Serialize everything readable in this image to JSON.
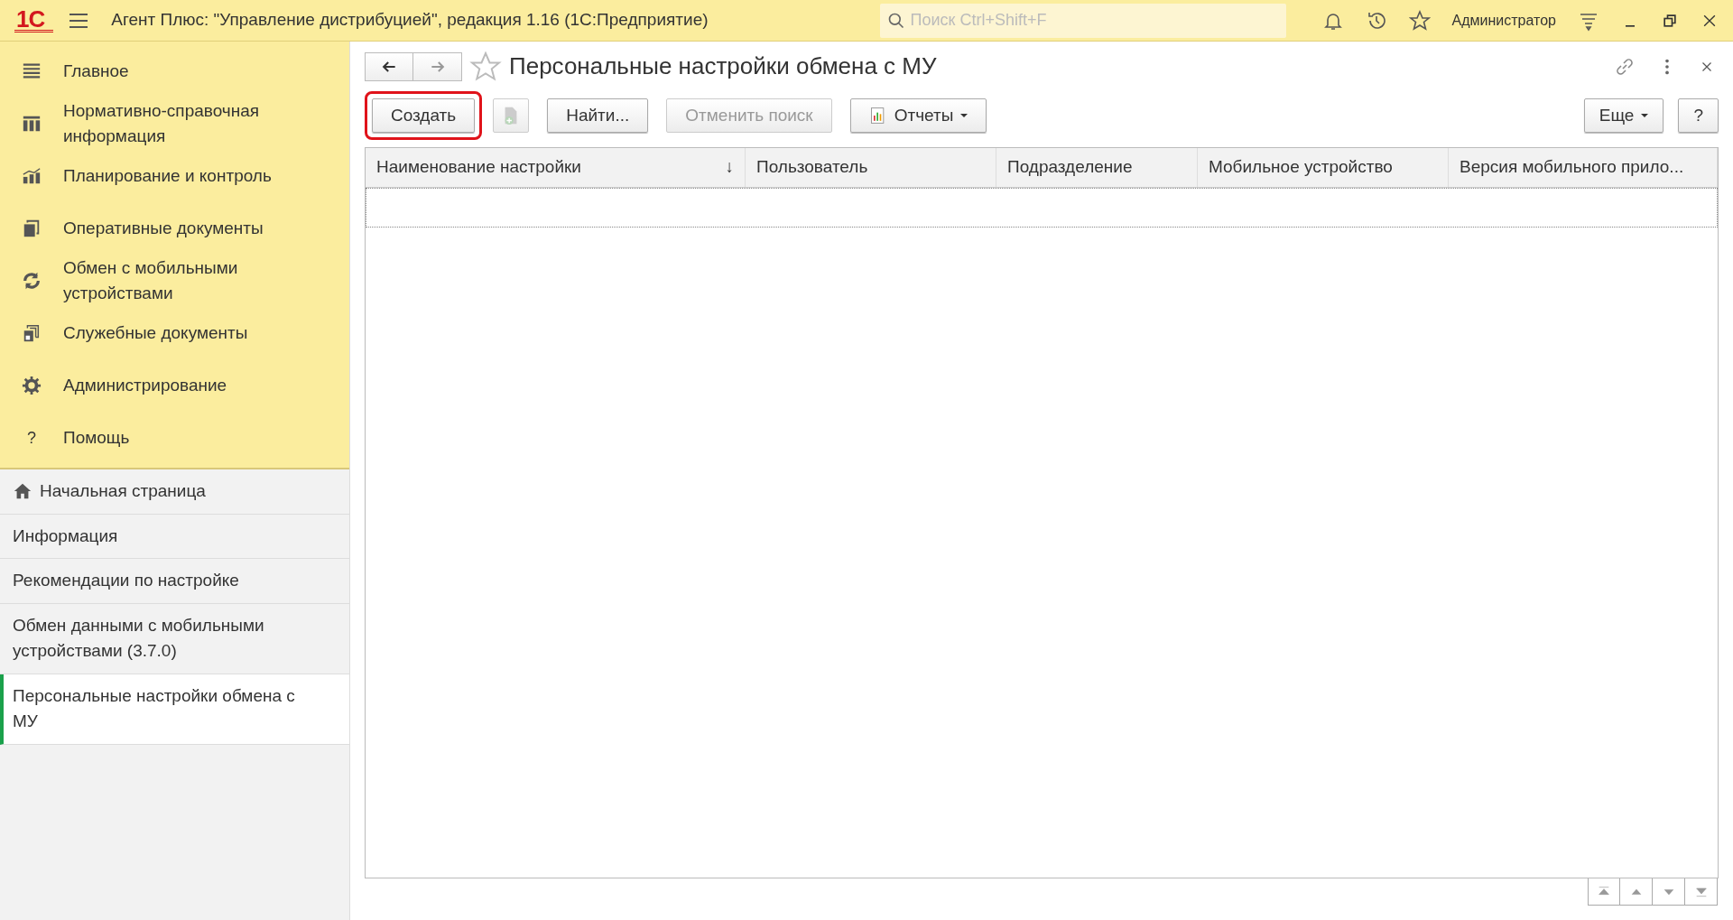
{
  "app_bar": {
    "logo": "1С",
    "title": "Агент Плюс: \"Управление дистрибуцией\", редакция 1.16  (1С:Предприятие)",
    "search": {
      "placeholder": "Поиск Ctrl+Shift+F"
    },
    "user": "Администратор"
  },
  "sections": [
    {
      "label": "Главное",
      "kind": "lines"
    },
    {
      "label": "Нормативно-справочная информация",
      "kind": "columns"
    },
    {
      "label": "Планирование и контроль",
      "kind": "chart"
    },
    {
      "label": "Оперативные документы",
      "kind": "docs"
    },
    {
      "label": "Обмен с мобильными устройствами",
      "kind": "sync"
    },
    {
      "label": "Служебные документы",
      "kind": "docs2"
    },
    {
      "label": "Администрирование",
      "kind": "gear"
    },
    {
      "label": "Помощь",
      "kind": "help",
      "glyph": "?"
    }
  ],
  "open_pages": [
    {
      "label": "Начальная страница",
      "home": true,
      "selected": false
    },
    {
      "label": "Информация",
      "home": false,
      "selected": false
    },
    {
      "label": "Рекомендации по настройке",
      "home": false,
      "selected": false
    },
    {
      "label": "Обмен данными с мобильными устройствами (3.7.0)",
      "home": false,
      "selected": false
    },
    {
      "label": "Персональные настройки обмена с МУ",
      "home": false,
      "selected": true
    }
  ],
  "form": {
    "title": "Персональные настройки обмена с МУ",
    "favorite": false,
    "toolbar": [
      {
        "kind": "button",
        "label": "Создать",
        "disabled": false,
        "highlighted": true
      },
      {
        "kind": "icon",
        "disabled": true,
        "highlighted": false
      },
      {
        "kind": "button",
        "label": "Найти...",
        "disabled": false,
        "highlighted": false
      },
      {
        "kind": "button",
        "label": "Отменить поиск",
        "disabled": true,
        "highlighted": false
      },
      {
        "kind": "report",
        "label": "Отчеты",
        "disabled": false,
        "highlighted": false
      }
    ],
    "toolbar_right": [
      {
        "kind": "menu",
        "label": "Еще"
      },
      {
        "kind": "button",
        "label": "?"
      }
    ],
    "table": {
      "columns": [
        {
          "label": "Наименование настройки",
          "sort": "↓"
        },
        {
          "label": "Пользователь"
        },
        {
          "label": "Подразделение"
        },
        {
          "label": "Мобильное устройство"
        },
        {
          "label": "Версия мобильного прило..."
        }
      ]
    }
  }
}
